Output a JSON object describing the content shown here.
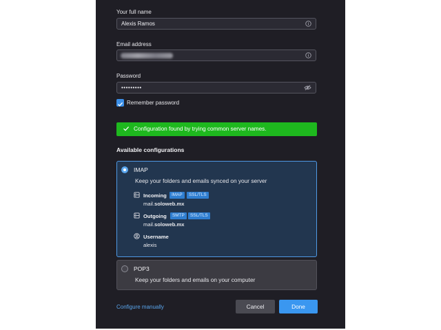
{
  "form": {
    "name_label": "Your full name",
    "name_value": "Alexis Ramos",
    "email_label": "Email address",
    "password_label": "Password",
    "password_value": "•••••••••",
    "remember_label": "Remember password",
    "remember_checked": true
  },
  "banner": {
    "text": "Configuration found by trying common server names."
  },
  "configs": {
    "heading": "Available configurations",
    "imap": {
      "title": "IMAP",
      "description": "Keep your folders and emails synced on your server",
      "selected": true,
      "incoming": {
        "label": "Incoming",
        "tags": [
          "IMAP",
          "SSL/TLS"
        ],
        "host_prefix": "mail.",
        "host_domain": "soloweb.mx"
      },
      "outgoing": {
        "label": "Outgoing",
        "tags": [
          "SMTP",
          "SSL/TLS"
        ],
        "host_prefix": "mail.",
        "host_domain": "soloweb.mx"
      },
      "username": {
        "label": "Username",
        "value": "alexis"
      }
    },
    "pop3": {
      "title": "POP3",
      "description": "Keep your folders and emails on your computer",
      "selected": false
    }
  },
  "footer": {
    "configure_manually": "Configure manually",
    "cancel": "Cancel",
    "done": "Done"
  },
  "colors": {
    "accent": "#3a97f0",
    "success": "#1eb81e",
    "panel": "#1f1e25",
    "selected_card": "#22364f"
  }
}
